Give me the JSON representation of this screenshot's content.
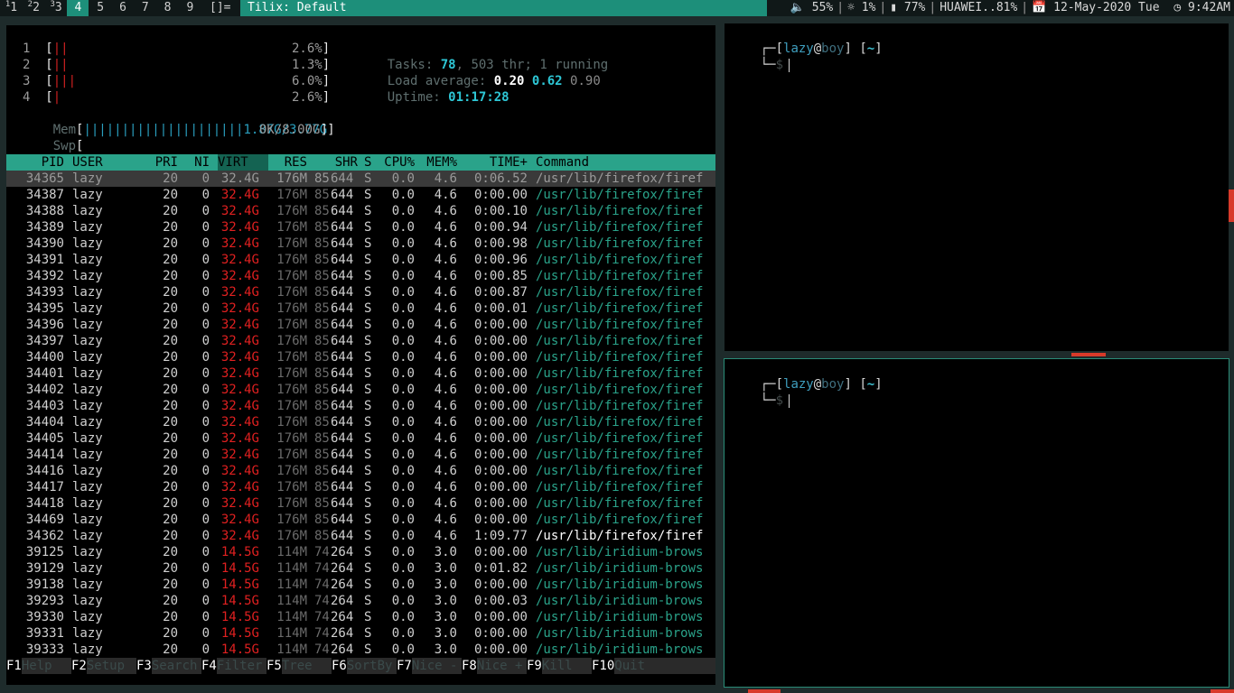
{
  "topbar": {
    "workspaces": [
      {
        "label": "1",
        "sub": "1",
        "active": false
      },
      {
        "label": "2",
        "sub": "2",
        "active": false
      },
      {
        "label": "3",
        "sub": "3",
        "active": false
      },
      {
        "label": "4",
        "sub": "",
        "active": true
      },
      {
        "label": "5",
        "sub": "",
        "active": false
      },
      {
        "label": "6",
        "sub": "",
        "active": false
      },
      {
        "label": "7",
        "sub": "",
        "active": false
      },
      {
        "label": "8",
        "sub": "",
        "active": false
      },
      {
        "label": "9",
        "sub": "",
        "active": false
      }
    ],
    "layout_indicator": "[]=",
    "window_title": "Tilix: Default",
    "status": {
      "volume": "🔈 55%",
      "brightness": "☼ 1%",
      "battery": "▮ 77%",
      "wifi": "HUAWEI..81%",
      "date": "📅 12-May-2020 Tue",
      "time": "◷ 9:42AM"
    }
  },
  "htop": {
    "cpus": [
      {
        "num": "1",
        "bars": "||",
        "pct": "2.6%"
      },
      {
        "num": "2",
        "bars": "||",
        "pct": "1.3%"
      },
      {
        "num": "3",
        "bars": "|||",
        "pct": "6.0%"
      },
      {
        "num": "4",
        "bars": "|",
        "pct": "2.6%"
      }
    ],
    "mem": {
      "label": "Mem",
      "bars": "|||||||||||||||||||||",
      "value": "1.87G/3.77G"
    },
    "swp": {
      "label": "Swp",
      "value": "0K/8.00G"
    },
    "tasks": {
      "label": "Tasks:",
      "count": "78",
      "thr": "503",
      "thr_label": "thr;",
      "running": "1",
      "running_label": "running"
    },
    "load": {
      "label": "Load average:",
      "l1": "0.20",
      "l5": "0.62",
      "l15": "0.90"
    },
    "uptime": {
      "label": "Uptime:",
      "value": "01:17:28"
    },
    "columns": [
      "PID",
      "USER",
      "PRI",
      "NI",
      "VIRT",
      "RES",
      "SHR",
      "S",
      "CPU%",
      "MEM%",
      "TIME+",
      "Command"
    ],
    "rows": [
      {
        "pid": "34365",
        "user": "lazy",
        "pri": "20",
        "ni": "0",
        "virt": "32.4G",
        "res": "176M",
        "shr1": "85",
        "shr2": "644",
        "s": "S",
        "cpu": "0.0",
        "mem": "4.6",
        "time": "0:06.52",
        "cmd": "/usr/lib/firefox/firef",
        "selected": true
      },
      {
        "pid": "34387",
        "user": "lazy",
        "pri": "20",
        "ni": "0",
        "virt": "32.4G",
        "res": "176M",
        "shr1": "85",
        "shr2": "644",
        "s": "S",
        "cpu": "0.0",
        "mem": "4.6",
        "time": "0:00.00",
        "cmd": "/usr/lib/firefox/firef"
      },
      {
        "pid": "34388",
        "user": "lazy",
        "pri": "20",
        "ni": "0",
        "virt": "32.4G",
        "res": "176M",
        "shr1": "85",
        "shr2": "644",
        "s": "S",
        "cpu": "0.0",
        "mem": "4.6",
        "time": "0:00.10",
        "cmd": "/usr/lib/firefox/firef"
      },
      {
        "pid": "34389",
        "user": "lazy",
        "pri": "20",
        "ni": "0",
        "virt": "32.4G",
        "res": "176M",
        "shr1": "85",
        "shr2": "644",
        "s": "S",
        "cpu": "0.0",
        "mem": "4.6",
        "time": "0:00.94",
        "cmd": "/usr/lib/firefox/firef"
      },
      {
        "pid": "34390",
        "user": "lazy",
        "pri": "20",
        "ni": "0",
        "virt": "32.4G",
        "res": "176M",
        "shr1": "85",
        "shr2": "644",
        "s": "S",
        "cpu": "0.0",
        "mem": "4.6",
        "time": "0:00.98",
        "cmd": "/usr/lib/firefox/firef"
      },
      {
        "pid": "34391",
        "user": "lazy",
        "pri": "20",
        "ni": "0",
        "virt": "32.4G",
        "res": "176M",
        "shr1": "85",
        "shr2": "644",
        "s": "S",
        "cpu": "0.0",
        "mem": "4.6",
        "time": "0:00.96",
        "cmd": "/usr/lib/firefox/firef"
      },
      {
        "pid": "34392",
        "user": "lazy",
        "pri": "20",
        "ni": "0",
        "virt": "32.4G",
        "res": "176M",
        "shr1": "85",
        "shr2": "644",
        "s": "S",
        "cpu": "0.0",
        "mem": "4.6",
        "time": "0:00.85",
        "cmd": "/usr/lib/firefox/firef"
      },
      {
        "pid": "34393",
        "user": "lazy",
        "pri": "20",
        "ni": "0",
        "virt": "32.4G",
        "res": "176M",
        "shr1": "85",
        "shr2": "644",
        "s": "S",
        "cpu": "0.0",
        "mem": "4.6",
        "time": "0:00.87",
        "cmd": "/usr/lib/firefox/firef"
      },
      {
        "pid": "34395",
        "user": "lazy",
        "pri": "20",
        "ni": "0",
        "virt": "32.4G",
        "res": "176M",
        "shr1": "85",
        "shr2": "644",
        "s": "S",
        "cpu": "0.0",
        "mem": "4.6",
        "time": "0:00.01",
        "cmd": "/usr/lib/firefox/firef"
      },
      {
        "pid": "34396",
        "user": "lazy",
        "pri": "20",
        "ni": "0",
        "virt": "32.4G",
        "res": "176M",
        "shr1": "85",
        "shr2": "644",
        "s": "S",
        "cpu": "0.0",
        "mem": "4.6",
        "time": "0:00.00",
        "cmd": "/usr/lib/firefox/firef"
      },
      {
        "pid": "34397",
        "user": "lazy",
        "pri": "20",
        "ni": "0",
        "virt": "32.4G",
        "res": "176M",
        "shr1": "85",
        "shr2": "644",
        "s": "S",
        "cpu": "0.0",
        "mem": "4.6",
        "time": "0:00.00",
        "cmd": "/usr/lib/firefox/firef"
      },
      {
        "pid": "34400",
        "user": "lazy",
        "pri": "20",
        "ni": "0",
        "virt": "32.4G",
        "res": "176M",
        "shr1": "85",
        "shr2": "644",
        "s": "S",
        "cpu": "0.0",
        "mem": "4.6",
        "time": "0:00.00",
        "cmd": "/usr/lib/firefox/firef"
      },
      {
        "pid": "34401",
        "user": "lazy",
        "pri": "20",
        "ni": "0",
        "virt": "32.4G",
        "res": "176M",
        "shr1": "85",
        "shr2": "644",
        "s": "S",
        "cpu": "0.0",
        "mem": "4.6",
        "time": "0:00.00",
        "cmd": "/usr/lib/firefox/firef"
      },
      {
        "pid": "34402",
        "user": "lazy",
        "pri": "20",
        "ni": "0",
        "virt": "32.4G",
        "res": "176M",
        "shr1": "85",
        "shr2": "644",
        "s": "S",
        "cpu": "0.0",
        "mem": "4.6",
        "time": "0:00.00",
        "cmd": "/usr/lib/firefox/firef"
      },
      {
        "pid": "34403",
        "user": "lazy",
        "pri": "20",
        "ni": "0",
        "virt": "32.4G",
        "res": "176M",
        "shr1": "85",
        "shr2": "644",
        "s": "S",
        "cpu": "0.0",
        "mem": "4.6",
        "time": "0:00.00",
        "cmd": "/usr/lib/firefox/firef"
      },
      {
        "pid": "34404",
        "user": "lazy",
        "pri": "20",
        "ni": "0",
        "virt": "32.4G",
        "res": "176M",
        "shr1": "85",
        "shr2": "644",
        "s": "S",
        "cpu": "0.0",
        "mem": "4.6",
        "time": "0:00.00",
        "cmd": "/usr/lib/firefox/firef"
      },
      {
        "pid": "34405",
        "user": "lazy",
        "pri": "20",
        "ni": "0",
        "virt": "32.4G",
        "res": "176M",
        "shr1": "85",
        "shr2": "644",
        "s": "S",
        "cpu": "0.0",
        "mem": "4.6",
        "time": "0:00.00",
        "cmd": "/usr/lib/firefox/firef"
      },
      {
        "pid": "34414",
        "user": "lazy",
        "pri": "20",
        "ni": "0",
        "virt": "32.4G",
        "res": "176M",
        "shr1": "85",
        "shr2": "644",
        "s": "S",
        "cpu": "0.0",
        "mem": "4.6",
        "time": "0:00.00",
        "cmd": "/usr/lib/firefox/firef"
      },
      {
        "pid": "34416",
        "user": "lazy",
        "pri": "20",
        "ni": "0",
        "virt": "32.4G",
        "res": "176M",
        "shr1": "85",
        "shr2": "644",
        "s": "S",
        "cpu": "0.0",
        "mem": "4.6",
        "time": "0:00.00",
        "cmd": "/usr/lib/firefox/firef"
      },
      {
        "pid": "34417",
        "user": "lazy",
        "pri": "20",
        "ni": "0",
        "virt": "32.4G",
        "res": "176M",
        "shr1": "85",
        "shr2": "644",
        "s": "S",
        "cpu": "0.0",
        "mem": "4.6",
        "time": "0:00.00",
        "cmd": "/usr/lib/firefox/firef"
      },
      {
        "pid": "34418",
        "user": "lazy",
        "pri": "20",
        "ni": "0",
        "virt": "32.4G",
        "res": "176M",
        "shr1": "85",
        "shr2": "644",
        "s": "S",
        "cpu": "0.0",
        "mem": "4.6",
        "time": "0:00.00",
        "cmd": "/usr/lib/firefox/firef"
      },
      {
        "pid": "34469",
        "user": "lazy",
        "pri": "20",
        "ni": "0",
        "virt": "32.4G",
        "res": "176M",
        "shr1": "85",
        "shr2": "644",
        "s": "S",
        "cpu": "0.0",
        "mem": "4.6",
        "time": "0:00.00",
        "cmd": "/usr/lib/firefox/firef"
      },
      {
        "pid": "34362",
        "user": "lazy",
        "pri": "20",
        "ni": "0",
        "virt": "32.4G",
        "res": "176M",
        "shr1": "85",
        "shr2": "644",
        "s": "S",
        "cpu": "0.0",
        "mem": "4.6",
        "time": "1:09.77",
        "cmd": "/usr/lib/firefox/firef",
        "main": true
      },
      {
        "pid": "39125",
        "user": "lazy",
        "pri": "20",
        "ni": "0",
        "virt": "14.5G",
        "res": "114M",
        "shr1": "74",
        "shr2": "264",
        "s": "S",
        "cpu": "0.0",
        "mem": "3.0",
        "time": "0:00.00",
        "cmd": "/usr/lib/iridium-brows"
      },
      {
        "pid": "39129",
        "user": "lazy",
        "pri": "20",
        "ni": "0",
        "virt": "14.5G",
        "res": "114M",
        "shr1": "74",
        "shr2": "264",
        "s": "S",
        "cpu": "0.0",
        "mem": "3.0",
        "time": "0:01.82",
        "cmd": "/usr/lib/iridium-brows"
      },
      {
        "pid": "39138",
        "user": "lazy",
        "pri": "20",
        "ni": "0",
        "virt": "14.5G",
        "res": "114M",
        "shr1": "74",
        "shr2": "264",
        "s": "S",
        "cpu": "0.0",
        "mem": "3.0",
        "time": "0:00.00",
        "cmd": "/usr/lib/iridium-brows"
      },
      {
        "pid": "39293",
        "user": "lazy",
        "pri": "20",
        "ni": "0",
        "virt": "14.5G",
        "res": "114M",
        "shr1": "74",
        "shr2": "264",
        "s": "S",
        "cpu": "0.0",
        "mem": "3.0",
        "time": "0:00.03",
        "cmd": "/usr/lib/iridium-brows"
      },
      {
        "pid": "39330",
        "user": "lazy",
        "pri": "20",
        "ni": "0",
        "virt": "14.5G",
        "res": "114M",
        "shr1": "74",
        "shr2": "264",
        "s": "S",
        "cpu": "0.0",
        "mem": "3.0",
        "time": "0:00.00",
        "cmd": "/usr/lib/iridium-brows"
      },
      {
        "pid": "39331",
        "user": "lazy",
        "pri": "20",
        "ni": "0",
        "virt": "14.5G",
        "res": "114M",
        "shr1": "74",
        "shr2": "264",
        "s": "S",
        "cpu": "0.0",
        "mem": "3.0",
        "time": "0:00.00",
        "cmd": "/usr/lib/iridium-brows"
      },
      {
        "pid": "39333",
        "user": "lazy",
        "pri": "20",
        "ni": "0",
        "virt": "14.5G",
        "res": "114M",
        "shr1": "74",
        "shr2": "264",
        "s": "S",
        "cpu": "0.0",
        "mem": "3.0",
        "time": "0:00.00",
        "cmd": "/usr/lib/iridium-brows"
      }
    ],
    "fkeys": [
      {
        "key": "F1",
        "label": "Help"
      },
      {
        "key": "F2",
        "label": "Setup"
      },
      {
        "key": "F3",
        "label": "Search"
      },
      {
        "key": "F4",
        "label": "Filter"
      },
      {
        "key": "F5",
        "label": "Tree"
      },
      {
        "key": "F6",
        "label": "SortBy"
      },
      {
        "key": "F7",
        "label": "Nice -"
      },
      {
        "key": "F8",
        "label": "Nice +"
      },
      {
        "key": "F9",
        "label": "Kill"
      },
      {
        "key": "F10",
        "label": "Quit"
      }
    ]
  },
  "terminals": [
    {
      "user": "lazy",
      "at": "@",
      "host": "boy",
      "cwd": "~",
      "prompt": "$"
    },
    {
      "user": "lazy",
      "at": "@",
      "host": "boy",
      "cwd": "~",
      "prompt": "$"
    }
  ],
  "colors": {
    "accent": "#1d8f7a",
    "htop_header": "#2aa38a",
    "virt_red": "#e02020",
    "decor_red": "#d83a2a"
  }
}
